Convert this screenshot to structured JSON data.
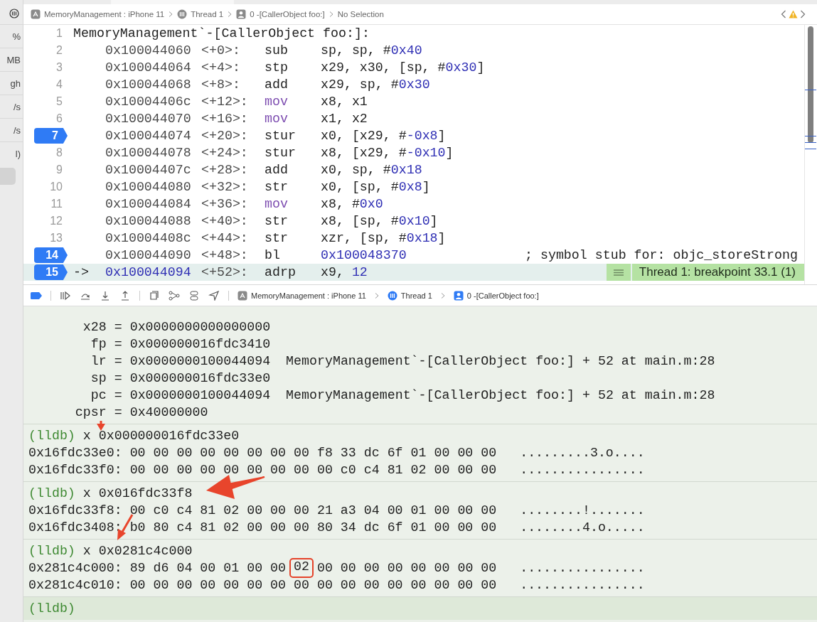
{
  "sidebar": {
    "items": [
      {
        "text": "%",
        "selected": false
      },
      {
        "text": "MB",
        "selected": false
      },
      {
        "text": "gh",
        "selected": false
      },
      {
        "text": "/s",
        "selected": false
      },
      {
        "text": "/s",
        "selected": false
      },
      {
        "text": "l)",
        "selected": false
      },
      {
        "selected": true
      }
    ]
  },
  "jump_bar": {
    "crumbs": [
      {
        "kind": "app",
        "text": "MemoryManagement : iPhone 11"
      },
      {
        "kind": "thread",
        "text": "Thread 1"
      },
      {
        "kind": "frame",
        "text": "0 -[CallerObject foo:]"
      },
      {
        "kind": "plain",
        "text": "No Selection"
      }
    ]
  },
  "code": {
    "lines": [
      {
        "number": "1",
        "breakpoint": false,
        "current": false,
        "kind": "label",
        "text": "MemoryManagement`-[CallerObject foo:]:"
      },
      {
        "number": "2",
        "breakpoint": false,
        "current": false,
        "kind": "instruction",
        "address": "0x100044060",
        "offset": "<+0>:",
        "mnemonic": {
          "text": "sub",
          "kind": "plain"
        },
        "operands": [
          {
            "text": "sp, sp, #",
            "kind": "plain"
          },
          {
            "text": "0x40",
            "kind": "number"
          }
        ]
      },
      {
        "number": "3",
        "breakpoint": false,
        "current": false,
        "kind": "instruction",
        "address": "0x100044064",
        "offset": "<+4>:",
        "mnemonic": {
          "text": "stp",
          "kind": "plain"
        },
        "operands": [
          {
            "text": "x29, x30, [sp, #",
            "kind": "plain"
          },
          {
            "text": "0x30",
            "kind": "number"
          },
          {
            "text": "]",
            "kind": "plain"
          }
        ]
      },
      {
        "number": "4",
        "breakpoint": false,
        "current": false,
        "kind": "instruction",
        "address": "0x100044068",
        "offset": "<+8>:",
        "mnemonic": {
          "text": "add",
          "kind": "plain"
        },
        "operands": [
          {
            "text": "x29, sp, #",
            "kind": "plain"
          },
          {
            "text": "0x30",
            "kind": "number"
          }
        ]
      },
      {
        "number": "5",
        "breakpoint": false,
        "current": false,
        "kind": "instruction",
        "address": "0x10004406c",
        "offset": "<+12>:",
        "mnemonic": {
          "text": "mov",
          "kind": "move"
        },
        "operands": [
          {
            "text": "x8, x1",
            "kind": "plain"
          }
        ]
      },
      {
        "number": "6",
        "breakpoint": false,
        "current": false,
        "kind": "instruction",
        "address": "0x100044070",
        "offset": "<+16>:",
        "mnemonic": {
          "text": "mov",
          "kind": "move"
        },
        "operands": [
          {
            "text": "x1, x2",
            "kind": "plain"
          }
        ]
      },
      {
        "number": "7",
        "breakpoint": true,
        "current": false,
        "kind": "instruction",
        "address": "0x100044074",
        "offset": "<+20>:",
        "mnemonic": {
          "text": "stur",
          "kind": "plain"
        },
        "operands": [
          {
            "text": "x0, [x29, #",
            "kind": "plain"
          },
          {
            "text": "-0x8",
            "kind": "number"
          },
          {
            "text": "]",
            "kind": "plain"
          }
        ]
      },
      {
        "number": "8",
        "breakpoint": false,
        "current": false,
        "kind": "instruction",
        "address": "0x100044078",
        "offset": "<+24>:",
        "mnemonic": {
          "text": "stur",
          "kind": "plain"
        },
        "operands": [
          {
            "text": "x8, [x29, #",
            "kind": "plain"
          },
          {
            "text": "-0x10",
            "kind": "number"
          },
          {
            "text": "]",
            "kind": "plain"
          }
        ]
      },
      {
        "number": "9",
        "breakpoint": false,
        "current": false,
        "kind": "instruction",
        "address": "0x10004407c",
        "offset": "<+28>:",
        "mnemonic": {
          "text": "add",
          "kind": "plain"
        },
        "operands": [
          {
            "text": "x0, sp, #",
            "kind": "plain"
          },
          {
            "text": "0x18",
            "kind": "number"
          }
        ]
      },
      {
        "number": "10",
        "breakpoint": false,
        "current": false,
        "kind": "instruction",
        "address": "0x100044080",
        "offset": "<+32>:",
        "mnemonic": {
          "text": "str",
          "kind": "plain"
        },
        "operands": [
          {
            "text": "x0, [sp, #",
            "kind": "plain"
          },
          {
            "text": "0x8",
            "kind": "number"
          },
          {
            "text": "]",
            "kind": "plain"
          }
        ]
      },
      {
        "number": "11",
        "breakpoint": false,
        "current": false,
        "kind": "instruction",
        "address": "0x100044084",
        "offset": "<+36>:",
        "mnemonic": {
          "text": "mov",
          "kind": "move"
        },
        "operands": [
          {
            "text": "x8, #",
            "kind": "plain"
          },
          {
            "text": "0x0",
            "kind": "number"
          }
        ]
      },
      {
        "number": "12",
        "breakpoint": false,
        "current": false,
        "kind": "instruction",
        "address": "0x100044088",
        "offset": "<+40>:",
        "mnemonic": {
          "text": "str",
          "kind": "plain"
        },
        "operands": [
          {
            "text": "x8, [sp, #",
            "kind": "plain"
          },
          {
            "text": "0x10",
            "kind": "number"
          },
          {
            "text": "]",
            "kind": "plain"
          }
        ]
      },
      {
        "number": "13",
        "breakpoint": false,
        "current": false,
        "kind": "instruction",
        "address": "0x10004408c",
        "offset": "<+44>:",
        "mnemonic": {
          "text": "str",
          "kind": "plain"
        },
        "operands": [
          {
            "text": "xzr, [sp, #",
            "kind": "plain"
          },
          {
            "text": "0x18",
            "kind": "number"
          },
          {
            "text": "]",
            "kind": "plain"
          }
        ]
      },
      {
        "number": "14",
        "breakpoint": true,
        "current": false,
        "kind": "instruction",
        "address": "0x100044090",
        "offset": "<+48>:",
        "mnemonic": {
          "text": "bl",
          "kind": "plain"
        },
        "operands": [
          {
            "text": "0x100048370",
            "kind": "number"
          }
        ],
        "comment": "; symbol stub for: objc_storeStrong"
      },
      {
        "number": "15",
        "breakpoint": true,
        "current": true,
        "pointer": "->",
        "kind": "instruction",
        "address": "0x100044094",
        "offset": "<+52>:",
        "mnemonic": {
          "text": "adrp",
          "kind": "plain"
        },
        "operands": [
          {
            "text": "x9, ",
            "kind": "plain"
          },
          {
            "text": "12",
            "kind": "number"
          }
        ],
        "annotation": "Thread 1: breakpoint 33.1 (1)"
      }
    ]
  },
  "debug_bar": {
    "breakpoints_active": true,
    "crumbs": [
      {
        "kind": "app",
        "text": "MemoryManagement : iPhone 11"
      },
      {
        "kind": "thread",
        "text": "Thread 1"
      },
      {
        "kind": "frame",
        "text": "0 -[CallerObject foo:]"
      }
    ]
  },
  "console": {
    "registers": [
      {
        "name": "x28",
        "sign": "=",
        "value": "0x0000000000000000"
      },
      {
        "name": "fp",
        "sign": "=",
        "value": "0x000000016fdc3410"
      },
      {
        "name": "lr",
        "sign": "=",
        "value": "0x0000000100044094",
        "symbol": "MemoryManagement`-[CallerObject foo:] + 52 at main.m:28"
      },
      {
        "name": "sp",
        "sign": "=",
        "value": "0x000000016fdc33e0"
      },
      {
        "name": "pc",
        "sign": "=",
        "value": "0x0000000100044094",
        "symbol": "MemoryManagement`-[CallerObject foo:] + 52 at main.m:28"
      },
      {
        "name": "cpsr",
        "sign": "=",
        "value": "0x40000000"
      }
    ],
    "commands": [
      {
        "prompt": "(lldb)",
        "command": "x 0x000000016fdc33e0",
        "rows": [
          {
            "address": "0x16fdc33e0:",
            "bytes": "00 00 00 00 00 00 00 00 f8 33 dc 6f 01 00 00 00",
            "ascii": ".........3.o...."
          },
          {
            "address": "0x16fdc33f0:",
            "bytes": "00 00 00 00 00 00 00 00 00 c0 c4 81 02 00 00 00",
            "ascii": "................"
          }
        ]
      },
      {
        "prompt": "(lldb)",
        "command": "x 0x016fdc33f8",
        "rows": [
          {
            "address": "0x16fdc33f8:",
            "bytes": "00 c0 c4 81 02 00 00 00 21 a3 04 00 01 00 00 00",
            "ascii": "........!......."
          },
          {
            "address": "0x16fdc3408:",
            "bytes": "b0 80 c4 81 02 00 00 00 80 34 dc 6f 01 00 00 00",
            "ascii": "........4.o....."
          }
        ]
      },
      {
        "prompt": "(lldb)",
        "command": "x 0x0281c4c000",
        "rows": [
          {
            "address": "0x281c4c000:",
            "bytes": "89 d6 04 00 01 00 00",
            "boxed_byte": "02",
            "bytes_after": "00 00 00 00 00 00 00 00",
            "ascii": "................"
          },
          {
            "address": "0x281c4c010:",
            "bytes": "00 00 00 00 00 00 00 00 00 00 00 00 00 00 00 00",
            "ascii": "................"
          }
        ]
      }
    ],
    "input_prompt": "(lldb)"
  }
}
